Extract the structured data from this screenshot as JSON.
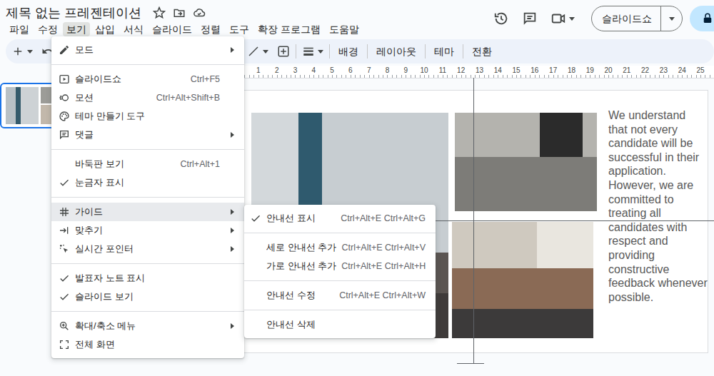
{
  "window": {
    "title": "제목 없는 프레젠테이션"
  },
  "menubar": [
    {
      "label": "파일",
      "selected": false
    },
    {
      "label": "수정",
      "selected": false
    },
    {
      "label": "보기",
      "selected": true
    },
    {
      "label": "삽입",
      "selected": false
    },
    {
      "label": "서식",
      "selected": false
    },
    {
      "label": "슬라이드",
      "selected": false
    },
    {
      "label": "정렬",
      "selected": false
    },
    {
      "label": "도구",
      "selected": false
    },
    {
      "label": "확장 프로그램",
      "selected": false
    },
    {
      "label": "도움말",
      "selected": false
    }
  ],
  "header": {
    "slideshow_button": "슬라이드쇼"
  },
  "toolbar": {
    "buttons": [
      "배경",
      "레이아웃",
      "테마",
      "전환"
    ]
  },
  "ruler": {
    "ticks": [
      "1",
      "2",
      "3",
      "4",
      "5",
      "6",
      "7",
      "8",
      "9",
      "10",
      "11",
      "12",
      "13",
      "14",
      "15",
      "16",
      "17",
      "18",
      "19",
      "20",
      "21",
      "22",
      "23",
      "24",
      "25"
    ]
  },
  "filmstrip": {
    "slides": [
      {
        "selected": true
      }
    ]
  },
  "view_menu": {
    "groups": [
      [
        {
          "label": "모드",
          "checked": false,
          "submenu": true,
          "highlighted": false
        }
      ],
      [
        {
          "label": "슬라이드쇼",
          "shortcut": "Ctrl+F5",
          "checked": false,
          "submenu": false,
          "highlighted": false
        },
        {
          "label": "모션",
          "shortcut": "Ctrl+Alt+Shift+B",
          "checked": false,
          "submenu": false,
          "highlighted": false
        },
        {
          "label": "테마 만들기 도구",
          "checked": false,
          "submenu": false,
          "highlighted": false
        },
        {
          "label": "댓글",
          "checked": false,
          "submenu": true,
          "highlighted": false
        }
      ],
      [
        {
          "label": "바둑판 보기",
          "shortcut": "Ctrl+Alt+1",
          "checked": false,
          "submenu": false,
          "highlighted": false
        },
        {
          "label": "눈금자 표시",
          "checked": true,
          "submenu": false,
          "highlighted": false
        }
      ],
      [
        {
          "label": "가이드",
          "checked": false,
          "submenu": true,
          "highlighted": true
        },
        {
          "label": "맞추기",
          "checked": false,
          "submenu": true,
          "highlighted": false
        },
        {
          "label": "실시간 포인터",
          "checked": false,
          "submenu": true,
          "highlighted": false
        }
      ],
      [
        {
          "label": "발표자 노트 표시",
          "checked": true,
          "submenu": false,
          "highlighted": false
        },
        {
          "label": "슬라이드 보기",
          "checked": true,
          "submenu": false,
          "highlighted": false
        }
      ],
      [
        {
          "label": "확대/축소 메뉴",
          "checked": false,
          "submenu": true,
          "highlighted": false
        },
        {
          "label": "전체 화면",
          "checked": false,
          "submenu": false,
          "highlighted": false
        }
      ]
    ]
  },
  "guides_submenu": {
    "groups": [
      [
        {
          "label": "안내선 표시",
          "shortcut": "Ctrl+Alt+E Ctrl+Alt+G",
          "checked": true
        }
      ],
      [
        {
          "label": "세로 안내선 추가",
          "shortcut": "Ctrl+Alt+E Ctrl+Alt+V",
          "checked": false
        },
        {
          "label": "가로 안내선 추가",
          "shortcut": "Ctrl+Alt+E Ctrl+Alt+H",
          "checked": false
        }
      ],
      [
        {
          "label": "안내선 수정",
          "shortcut": "Ctrl+Alt+E Ctrl+Alt+W",
          "checked": false
        }
      ],
      [
        {
          "label": "안내선 삭제",
          "checked": false
        }
      ]
    ]
  },
  "slide": {
    "text": "We understand that not every candidate will be successful in their application. However, we are committed to treating all candidates with respect and providing constructive feedback whenever possible."
  }
}
